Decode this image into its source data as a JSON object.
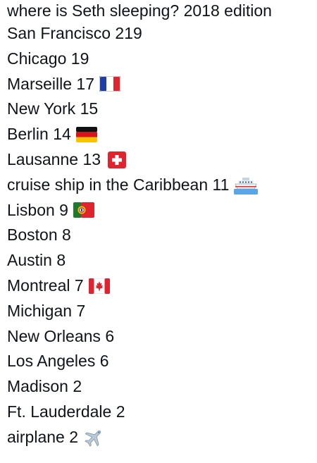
{
  "title": "where is Seth sleeping? 2018 edition",
  "items": [
    {
      "place": "San Francisco",
      "nights": "219",
      "icon": ""
    },
    {
      "place": "Chicago",
      "nights": "19",
      "icon": ""
    },
    {
      "place": "Marseille",
      "nights": "17",
      "icon": "france-flag-icon"
    },
    {
      "place": "New York",
      "nights": "15",
      "icon": ""
    },
    {
      "place": "Berlin",
      "nights": "14",
      "icon": "germany-flag-icon"
    },
    {
      "place": "Lausanne",
      "nights": "13",
      "icon": "switzerland-flag-icon"
    },
    {
      "place": "cruise ship in the Caribbean",
      "nights": "11",
      "icon": "ship-icon"
    },
    {
      "place": "Lisbon",
      "nights": "9",
      "icon": "portugal-flag-icon"
    },
    {
      "place": "Boston",
      "nights": "8",
      "icon": ""
    },
    {
      "place": "Austin",
      "nights": "8",
      "icon": ""
    },
    {
      "place": "Montreal",
      "nights": "7",
      "icon": "canada-flag-icon"
    },
    {
      "place": "Michigan",
      "nights": "7",
      "icon": ""
    },
    {
      "place": "New Orleans",
      "nights": "6",
      "icon": ""
    },
    {
      "place": "Los Angeles",
      "nights": "6",
      "icon": ""
    },
    {
      "place": "Madison",
      "nights": "2",
      "icon": ""
    },
    {
      "place": "Ft. Lauderdale",
      "nights": "2",
      "icon": ""
    },
    {
      "place": "airplane",
      "nights": "2",
      "icon": "airplane-icon"
    }
  ]
}
